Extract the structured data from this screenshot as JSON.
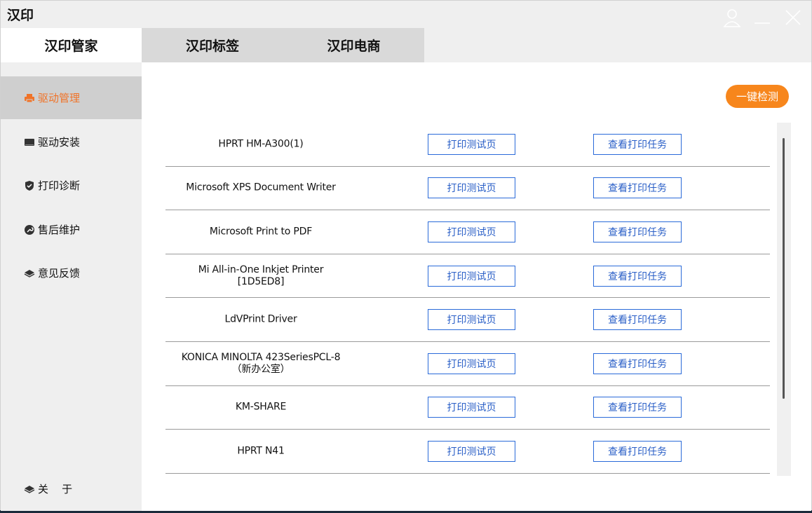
{
  "window": {
    "title": "汉印"
  },
  "tabs": [
    {
      "label": "汉印管家",
      "active": true
    },
    {
      "label": "汉印标签",
      "active": false
    },
    {
      "label": "汉印电商",
      "active": false
    }
  ],
  "sidebar": {
    "items": [
      {
        "label": "驱动管理",
        "icon": "printer-icon",
        "active": true
      },
      {
        "label": "驱动安装",
        "icon": "drive-icon",
        "active": false
      },
      {
        "label": "打印诊断",
        "icon": "shield-icon",
        "active": false
      },
      {
        "label": "售后维护",
        "icon": "wrench-icon",
        "active": false
      },
      {
        "label": "意见反馈",
        "icon": "layers-icon",
        "active": false
      }
    ],
    "about_label": "关    于"
  },
  "main": {
    "detect_button": "一键检测",
    "printers": [
      {
        "name": "HPRT HM-A300(1)"
      },
      {
        "name": "Microsoft XPS Document Writer"
      },
      {
        "name": "Microsoft Print to PDF"
      },
      {
        "name": "Mi All-in-One Inkjet Printer\n[1D5ED8]"
      },
      {
        "name": "LdVPrint Driver"
      },
      {
        "name": "KONICA MINOLTA 423SeriesPCL-8\n（新办公室）"
      },
      {
        "name": "KM-SHARE"
      },
      {
        "name": "HPRT N41"
      }
    ],
    "test_page_label": "打印测试页",
    "view_jobs_label": "查看打印任务"
  },
  "colors": {
    "accent_orange": "#f7861c",
    "active_text": "#f07328",
    "button_blue": "#2a6ad9"
  }
}
